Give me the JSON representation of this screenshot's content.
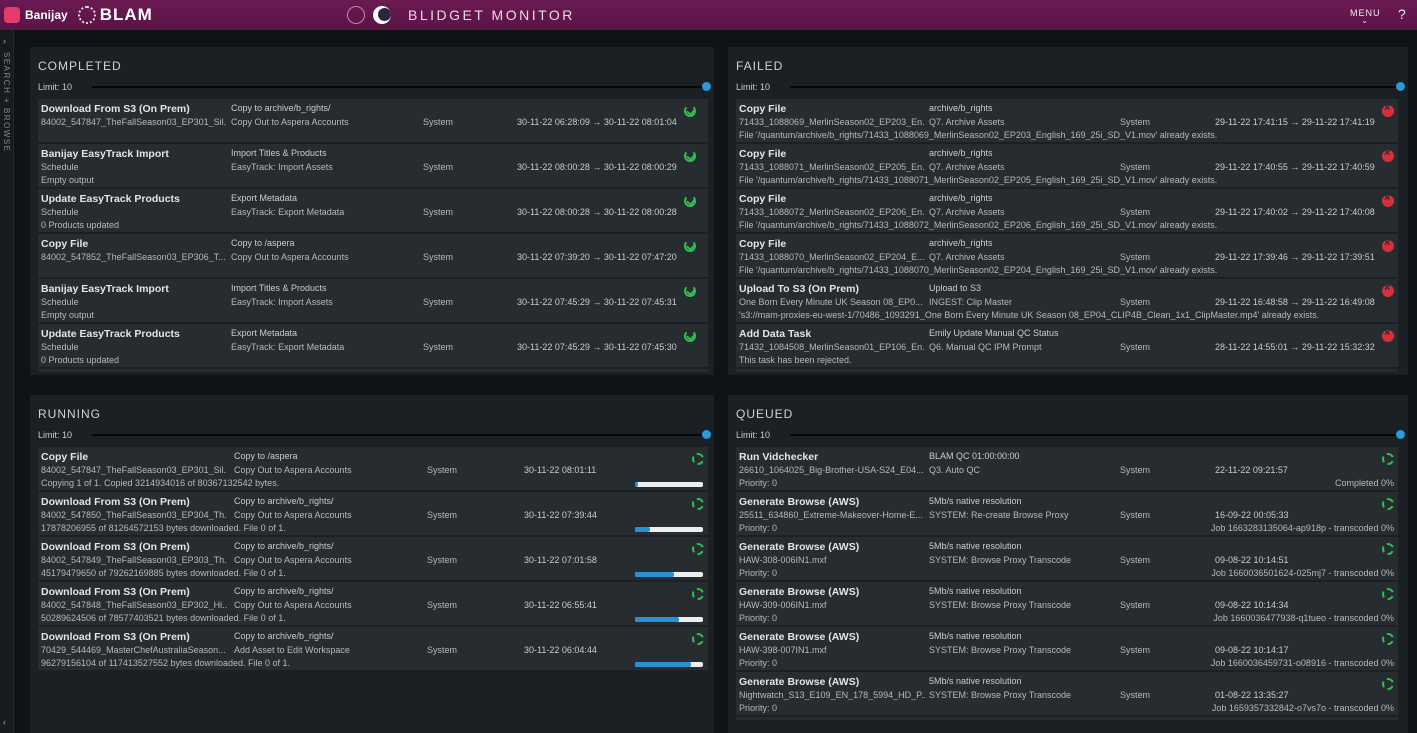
{
  "brand": {
    "name": "Banijay",
    "product": "BLAM"
  },
  "app_title": "BLIDGET MONITOR",
  "menu_label": "MENU",
  "help_label": "?",
  "sidebar": {
    "label": "SEARCH + BROWSE",
    "collapse_top": "›",
    "collapse_bottom": "‹"
  },
  "completed": {
    "title": "COMPLETED",
    "limit": "Limit: 10",
    "limit_fraction": 1.0,
    "rows": [
      {
        "title": "Download From S3 (On Prem)",
        "sub": "84002_547847_TheFallSeason03_EP301_Sil...",
        "desc": "Copy to archive/b_rights/",
        "desc2": "Copy Out to Aspera Accounts",
        "user": "System",
        "time": "30-11-22 06:28:09 → 30-11-22 08:01:04",
        "out": ""
      },
      {
        "title": "Banijay EasyTrack Import",
        "sub": "Schedule",
        "desc": "Import Titles & Products",
        "desc2": "EasyTrack: Import Assets",
        "user": "System",
        "time": "30-11-22 08:00:28 → 30-11-22 08:00:29",
        "out": "Empty output"
      },
      {
        "title": "Update EasyTrack Products",
        "sub": "Schedule",
        "desc": "Export Metadata",
        "desc2": "EasyTrack: Export Metadata",
        "user": "System",
        "time": "30-11-22 08:00:28 → 30-11-22 08:00:28",
        "out": "0 Products updated"
      },
      {
        "title": "Copy File",
        "sub": "84002_547852_TheFallSeason03_EP306_T...",
        "desc": "Copy to /aspera",
        "desc2": "Copy Out to Aspera Accounts",
        "user": "System",
        "time": "30-11-22 07:39:20 → 30-11-22 07:47:20",
        "out": ""
      },
      {
        "title": "Banijay EasyTrack Import",
        "sub": "Schedule",
        "desc": "Import Titles & Products",
        "desc2": "EasyTrack: Import Assets",
        "user": "System",
        "time": "30-11-22 07:45:29 → 30-11-22 07:45:31",
        "out": "Empty output"
      },
      {
        "title": "Update EasyTrack Products",
        "sub": "Schedule",
        "desc": "Export Metadata",
        "desc2": "EasyTrack: Export Metadata",
        "user": "System",
        "time": "30-11-22 07:45:29 → 30-11-22 07:45:30",
        "out": "0 Products updated"
      }
    ]
  },
  "failed": {
    "title": "FAILED",
    "limit": "Limit: 10",
    "limit_fraction": 1.0,
    "rows": [
      {
        "title": "Copy File",
        "sub": "71433_1088069_MerlinSeason02_EP203_En...",
        "desc": "archive/b_rights",
        "desc2": "Q7. Archive Assets",
        "user": "System",
        "time": "29-11-22 17:41:15 → 29-11-22 17:41:19",
        "out": "File '/quantum/archive/b_rights/71433_1088069_MerlinSeason02_EP203_English_169_25i_SD_V1.mov' already exists."
      },
      {
        "title": "Copy File",
        "sub": "71433_1088071_MerlinSeason02_EP205_En...",
        "desc": "archive/b_rights",
        "desc2": "Q7. Archive Assets",
        "user": "System",
        "time": "29-11-22 17:40:55 → 29-11-22 17:40:59",
        "out": "File '/quantum/archive/b_rights/71433_1088071_MerlinSeason02_EP205_English_169_25i_SD_V1.mov' already exists."
      },
      {
        "title": "Copy File",
        "sub": "71433_1088072_MerlinSeason02_EP206_En...",
        "desc": "archive/b_rights",
        "desc2": "Q7. Archive Assets",
        "user": "System",
        "time": "29-11-22 17:40:02 → 29-11-22 17:40:08",
        "out": "File '/quantum/archive/b_rights/71433_1088072_MerlinSeason02_EP206_English_169_25i_SD_V1.mov' already exists."
      },
      {
        "title": "Copy File",
        "sub": "71433_1088070_MerlinSeason02_EP204_E...",
        "desc": "archive/b_rights",
        "desc2": "Q7. Archive Assets",
        "user": "System",
        "time": "29-11-22 17:39:46 → 29-11-22 17:39:51",
        "out": "File '/quantum/archive/b_rights/71433_1088070_MerlinSeason02_EP204_English_169_25i_SD_V1.mov' already exists."
      },
      {
        "title": "Upload To S3 (On Prem)",
        "sub": "One Born Every Minute UK Season 08_EP0...",
        "desc": "Upload to S3",
        "desc2": "INGEST: Clip Master",
        "user": "System",
        "time": "29-11-22 16:48:58 → 29-11-22 16:49:08",
        "out": "'s3://mam-proxies-eu-west-1/70486_1093291_One Born Every Minute UK Season 08_EP04_CLIP4B_Clean_1x1_ClipMaster.mp4' already exists."
      },
      {
        "title": "Add Data Task",
        "sub": "71432_1084508_MerlinSeason01_EP106_En...",
        "desc": "Emily Update Manual QC Status",
        "desc2": "Q6. Manual QC IPM Prompt",
        "user": "System",
        "time": "28-11-22 14:55:01 → 29-11-22 15:32:32",
        "out": "This task has been rejected."
      }
    ]
  },
  "running": {
    "title": "RUNNING",
    "limit": "Limit: 10",
    "limit_fraction": 1.0,
    "rows": [
      {
        "title": "Copy File",
        "sub": "84002_547847_TheFallSeason03_EP301_Sil...",
        "desc": "Copy to /aspera",
        "desc2": "Copy Out to Aspera Accounts",
        "user": "System",
        "time": "30-11-22 08:01:11",
        "out": "Copying 1 of 1. Copied 3214934016 of 80367132542 bytes.",
        "progress": 0.04
      },
      {
        "title": "Download From S3 (On Prem)",
        "sub": "84002_547850_TheFallSeason03_EP304_Th...",
        "desc": "Copy to archive/b_rights/",
        "desc2": "Copy Out to Aspera Accounts",
        "user": "System",
        "time": "30-11-22 07:39:44",
        "out": "17878206955 of 81264572153 bytes downloaded. File 0 of 1.",
        "progress": 0.22
      },
      {
        "title": "Download From S3 (On Prem)",
        "sub": "84002_547849_TheFallSeason03_EP303_Th...",
        "desc": "Copy to archive/b_rights/",
        "desc2": "Copy Out to Aspera Accounts",
        "user": "System",
        "time": "30-11-22 07:01:58",
        "out": "45179479650 of 79262169885 bytes downloaded. File 0 of 1.",
        "progress": 0.57
      },
      {
        "title": "Download From S3 (On Prem)",
        "sub": "84002_547848_TheFallSeason03_EP302_Hi...",
        "desc": "Copy to archive/b_rights/",
        "desc2": "Copy Out to Aspera Accounts",
        "user": "System",
        "time": "30-11-22 06:55:41",
        "out": "50289624506 of 78577403521 bytes downloaded. File 0 of 1.",
        "progress": 0.64
      },
      {
        "title": "Download From S3 (On Prem)",
        "sub": "70429_544469_MasterChefAustraliaSeason...",
        "desc": "Copy to archive/b_rights/",
        "desc2": "Add Asset to Edit Workspace",
        "user": "System",
        "time": "30-11-22 06:04:44",
        "out": "96279156104 of 117413527552 bytes downloaded. File 0 of 1.",
        "progress": 0.82
      }
    ]
  },
  "queued": {
    "title": "QUEUED",
    "limit": "Limit: 10",
    "limit_fraction": 1.0,
    "rows": [
      {
        "title": "Run Vidchecker",
        "sub": "26610_1064025_Big-Brother-USA-S24_E04...",
        "desc": "BLAM QC 01:00:00:00",
        "desc2": "Q3. Auto QC",
        "user": "System",
        "time": "22-11-22 09:21:57",
        "out": "Priority: 0",
        "right": "Completed 0%"
      },
      {
        "title": "Generate Browse (AWS)",
        "sub": "25511_634860_Extreme-Makeover-Home-E...",
        "desc": "5Mb/s native resolution",
        "desc2": "SYSTEM: Re-create Browse Proxy",
        "user": "System",
        "time": "16-09-22 00:05:33",
        "out": "Priority: 0",
        "right": "Job 1663283135064-ap918p - transcoded 0%"
      },
      {
        "title": "Generate Browse (AWS)",
        "sub": "HAW-308-006IN1.mxf",
        "desc": "5Mb/s native resolution",
        "desc2": "SYSTEM: Browse Proxy Transcode",
        "user": "System",
        "time": "09-08-22 10:14:51",
        "out": "Priority: 0",
        "right": "Job 1660036501624-025mj7 - transcoded 0%"
      },
      {
        "title": "Generate Browse (AWS)",
        "sub": "HAW-309-006IN1.mxf",
        "desc": "5Mb/s native resolution",
        "desc2": "SYSTEM: Browse Proxy Transcode",
        "user": "System",
        "time": "09-08-22 10:14:34",
        "out": "Priority: 0",
        "right": "Job 1660036477938-q1tueo - transcoded 0%"
      },
      {
        "title": "Generate Browse (AWS)",
        "sub": "HAW-398-007IN1.mxf",
        "desc": "5Mb/s native resolution",
        "desc2": "SYSTEM: Browse Proxy Transcode",
        "user": "System",
        "time": "09-08-22 10:14:17",
        "out": "Priority: 0",
        "right": "Job 1660036459731-o08916 - transcoded 0%"
      },
      {
        "title": "Generate Browse (AWS)",
        "sub": "Nightwatch_S13_E109_EN_178_5994_HD_P...",
        "desc": "5Mb/s native resolution",
        "desc2": "SYSTEM: Browse Proxy Transcode",
        "user": "System",
        "time": "01-08-22 13:35:27",
        "out": "Priority: 0",
        "right": "Job 1659357332842-o7vs7o - transcoded 0%"
      }
    ]
  }
}
